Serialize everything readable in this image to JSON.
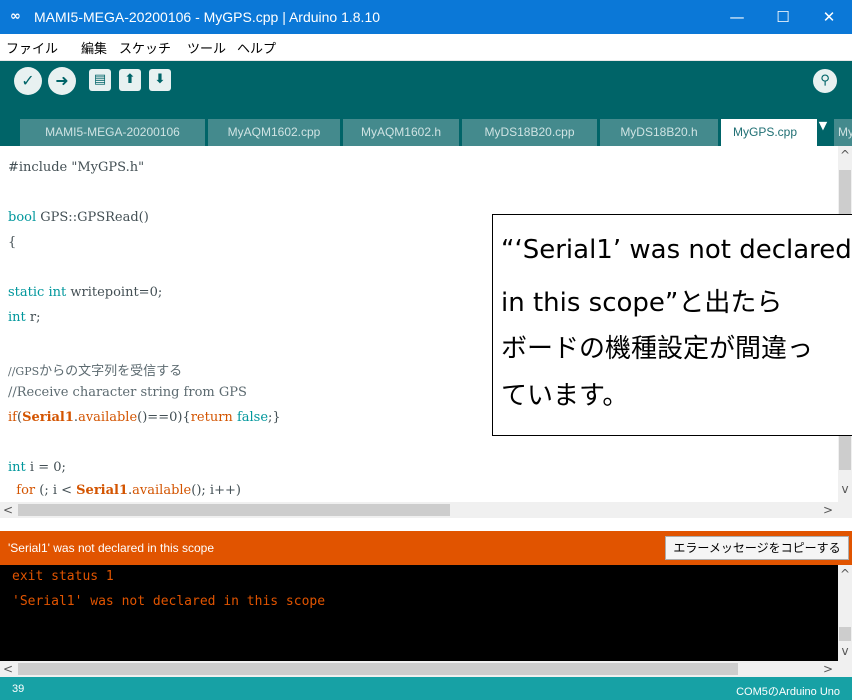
{
  "window": {
    "logo": "∞",
    "title": "MAMI5-MEGA-20200106 - MyGPS.cpp | Arduino 1.8.10",
    "controls": {
      "minimize": "—",
      "maximize": "☐",
      "close": "✕"
    }
  },
  "menu": [
    "ファイル",
    "編集",
    "スケッチ",
    "ツール",
    "ヘルプ"
  ],
  "toolbar": {
    "verify_icon": "✓",
    "upload_icon": "➜",
    "new_icon": "▤",
    "open_icon": "⬆",
    "save_icon": "⬇",
    "serial_monitor_icon": "⚲"
  },
  "tabs": [
    {
      "label": "MAMI5-MEGA-20200106"
    },
    {
      "label": "MyAQM1602.cpp"
    },
    {
      "label": "MyAQM1602.h"
    },
    {
      "label": "MyDS18B20.cpp"
    },
    {
      "label": "MyDS18B20.h"
    },
    {
      "label": "MyGPS.cpp"
    },
    {
      "label": "My"
    }
  ],
  "tab_menu_icon": "▼",
  "code": {
    "l1": "#include \"MyGPS.h\"",
    "l2_type": "bool",
    "l2_rest": " GPS::GPSRead()",
    "l3": "{",
    "l4_static": "static",
    "l4_sp": " ",
    "l4_int": "int",
    "l4_rest": " writepoint=0;",
    "l5_int": "int",
    "l5_rest": " r;",
    "l6_a": "//GPS",
    "l6_b": "からの文字列を受信する",
    "l7": "//Receive character string from GPS",
    "l8_if": "if",
    "l8_paren": "(",
    "l8_serial": "Serial1",
    "l8_dot": ".",
    "l8_available": "available",
    "l8_mid": "()==0){",
    "l8_return": "return",
    "l8_sp": " ",
    "l8_false": "false",
    "l8_end": ";}",
    "l9_int": "int",
    "l9_rest": " i = 0;",
    "l10_for": "  for",
    "l10_mid": " (; i < ",
    "l10_serial": "Serial1",
    "l10_dot": ".",
    "l10_available": "available",
    "l10_end": "(); i++)",
    "l11": "  {"
  },
  "callout": {
    "line1": "“‘Serial1’ was not declared",
    "line2": "in this scope”と出たら",
    "line3": "ボードの機種設定が間違っ",
    "line4": "ています。"
  },
  "error": {
    "message": "'Serial1' was not declared in this scope",
    "copy_button": "エラーメッセージをコピーする"
  },
  "console": {
    "line1": "exit status 1",
    "line2": "'Serial1' was not declared in this scope"
  },
  "status": {
    "line_number": "39",
    "board": "COM5のArduino Uno"
  },
  "scroll": {
    "up": "^",
    "down": "v",
    "left": "<",
    "right": ">"
  }
}
